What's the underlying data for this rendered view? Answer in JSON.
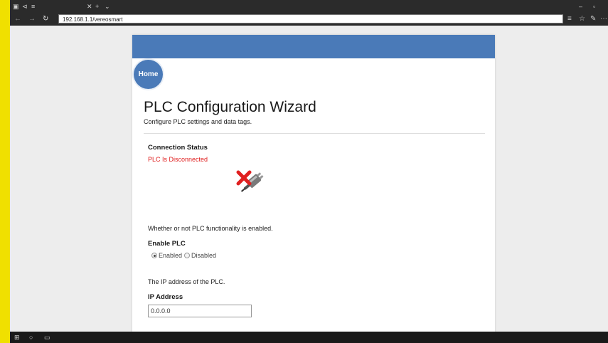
{
  "browser": {
    "tab_icons": [
      "tab-icon",
      "tab-preview-icon",
      "tab-list-icon"
    ],
    "url": "192.168.1.1/vereosmart",
    "window_controls": [
      "minimize-icon",
      "maximize-icon"
    ]
  },
  "page": {
    "home_label": "Home",
    "title": "PLC Configuration Wizard",
    "subtitle": "Configure PLC settings and data tags.",
    "connection": {
      "label": "Connection Status",
      "status": "PLC Is Disconnected",
      "status_color": "#e02020",
      "icon": "disconnected-plug-icon"
    },
    "enable_plc": {
      "description": "Whether or not PLC functionality is enabled.",
      "label": "Enable PLC",
      "options": [
        "Enabled",
        "Disabled"
      ],
      "selected": "Enabled"
    },
    "ip": {
      "description": "The IP address of the PLC.",
      "label": "IP Address",
      "value": "0.0.0.0"
    }
  },
  "colors": {
    "header": "#4a7ab8",
    "frame": "#f0e000"
  }
}
